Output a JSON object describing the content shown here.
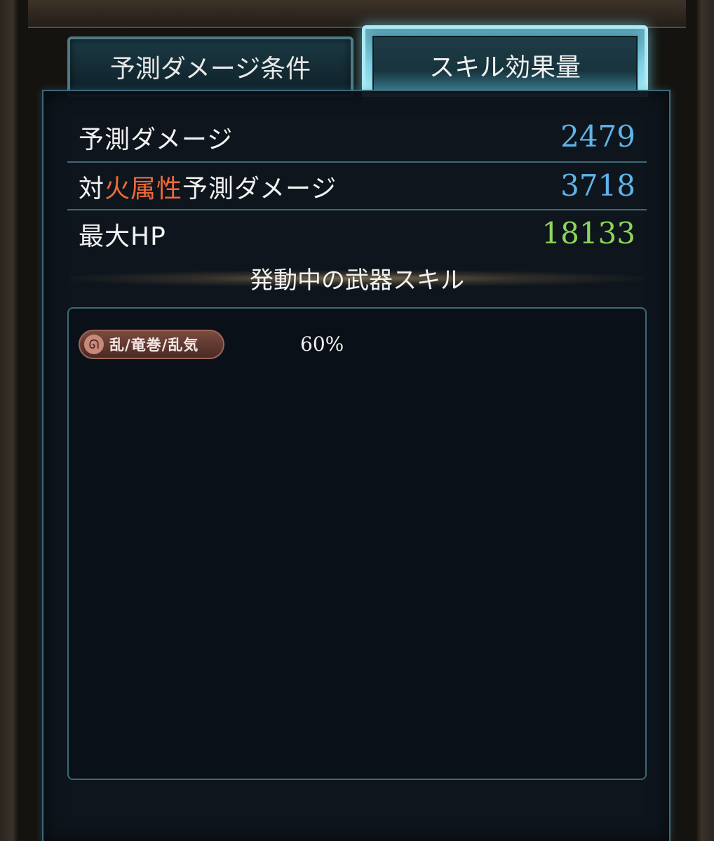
{
  "tabs": [
    {
      "label": "予測ダメージ条件",
      "active": false
    },
    {
      "label": "スキル効果量",
      "active": true
    }
  ],
  "stats": [
    {
      "label_parts": [
        "予測ダメージ"
      ],
      "value": "2479",
      "color": "#5fb3e8"
    },
    {
      "label_parts": [
        "対",
        "火属性",
        "予測ダメージ"
      ],
      "value": "3718",
      "color": "#5fb3e8"
    },
    {
      "label_parts": [
        "最大HP"
      ],
      "value": "18133",
      "color": "#8fd45a"
    }
  ],
  "section_title": "発動中の武器スキル",
  "skills": [
    {
      "name": "乱/竜巻/乱気",
      "value": "60%",
      "icon": "wind-element-icon"
    }
  ],
  "colors": {
    "fire_text": "#f0693a",
    "border": "#3e6878",
    "active_tab_glow": "#98e6f5"
  }
}
